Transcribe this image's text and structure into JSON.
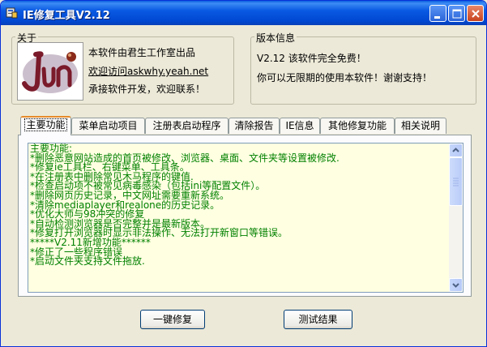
{
  "window": {
    "title": "IE修复工具V2.12"
  },
  "about": {
    "legend": "关于",
    "logo_text": "Jun",
    "line1": "本软件由君生工作室出品",
    "link": "欢迎访问askwhy.yeah.net",
    "line3": "承接软件开发，欢迎联系！"
  },
  "version": {
    "legend": "版本信息",
    "line1": "V2.12 该软件完全免费！",
    "line2": "你可以无限期的使用本软件！谢谢支持！"
  },
  "tabs": [
    {
      "label": "主要功能"
    },
    {
      "label": "菜单启动项目"
    },
    {
      "label": "注册表启动程序"
    },
    {
      "label": "清除报告"
    },
    {
      "label": "IE信息"
    },
    {
      "label": "其他修复功能"
    },
    {
      "label": "相关说明"
    }
  ],
  "content": {
    "lines": [
      "主要功能:",
      "*删除恶意网站造成的首页被修改、浏览器、桌面、文件夹等设置被修改.",
      "*修复ie工具栏、右键菜单、工具条。",
      "*在注册表中删除常见木马程序的键值.",
      "*检查启动项不被常见病毒感染（包括ini等配置文件）。",
      "*删除网页历史记录，中文网址需要重新系统。",
      "*清除mediaplayer和realone的历史记录。",
      "*优化大师与98冲突的修复",
      "*自动检测浏览器是否完整并是最新版本。",
      "*修复打开浏览器时显示非法操作、无法打开新窗口等错误。",
      "*****V2.11新增功能******",
      "*修正了一些程序错误",
      "*启动文件夹支持文件拖放."
    ]
  },
  "buttons": {
    "fix": "一键修复",
    "test": "测试结果"
  },
  "colors": {
    "title_bar": "#0a5ae3",
    "content_bg": "#ffffe1",
    "content_text": "#008000",
    "window_bg": "#ece9d8"
  }
}
